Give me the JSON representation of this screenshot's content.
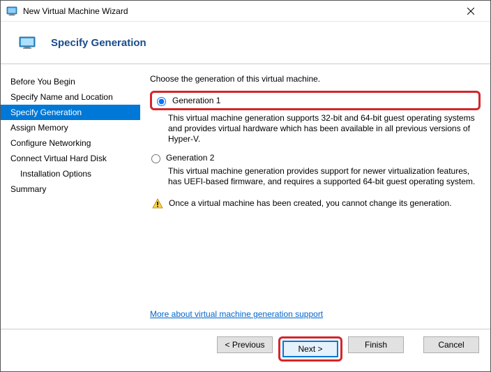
{
  "window": {
    "title": "New Virtual Machine Wizard"
  },
  "header": {
    "page_title": "Specify Generation"
  },
  "sidebar": {
    "items": [
      {
        "label": "Before You Begin"
      },
      {
        "label": "Specify Name and Location"
      },
      {
        "label": "Specify Generation"
      },
      {
        "label": "Assign Memory"
      },
      {
        "label": "Configure Networking"
      },
      {
        "label": "Connect Virtual Hard Disk"
      },
      {
        "label": "Installation Options"
      },
      {
        "label": "Summary"
      }
    ]
  },
  "main": {
    "prompt": "Choose the generation of this virtual machine.",
    "gen1": {
      "label": "Generation 1",
      "desc": "This virtual machine generation supports 32-bit and 64-bit guest operating systems and provides virtual hardware which has been available in all previous versions of Hyper-V."
    },
    "gen2": {
      "label": "Generation 2",
      "desc": "This virtual machine generation provides support for newer virtualization features, has UEFI-based firmware, and requires a supported 64-bit guest operating system."
    },
    "warning": "Once a virtual machine has been created, you cannot change its generation.",
    "link": "More about virtual machine generation support"
  },
  "footer": {
    "previous": "< Previous",
    "next": "Next >",
    "finish": "Finish",
    "cancel": "Cancel"
  }
}
